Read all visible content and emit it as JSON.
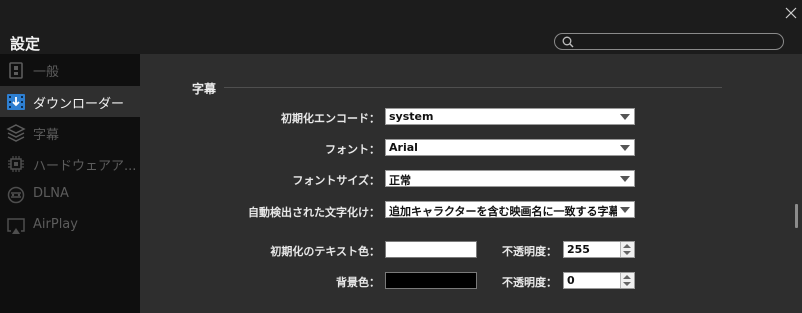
{
  "window": {
    "title": "設定"
  },
  "search": {
    "value": "",
    "placeholder": ""
  },
  "sidebar": {
    "items": [
      {
        "label": "一般",
        "icon": "general-icon",
        "active": false
      },
      {
        "label": "ダウンローダー",
        "icon": "download-icon",
        "active": true
      },
      {
        "label": "字幕",
        "icon": "subtitle-layers-icon",
        "active": false
      },
      {
        "label": "ハードウェアア...",
        "icon": "chip-icon",
        "active": false
      },
      {
        "label": "DLNA",
        "icon": "dlna-icon",
        "active": false
      },
      {
        "label": "AirPlay",
        "icon": "airplay-icon",
        "active": false
      }
    ]
  },
  "subtitle_section": {
    "title": "字幕",
    "initial_encoding": {
      "label": "初期化エンコード：",
      "value": "system"
    },
    "font": {
      "label": "フォント：",
      "value": "Arial"
    },
    "font_size": {
      "label": "フォントサイズ：",
      "value": "正常"
    },
    "auto_detected_charset": {
      "label": "自動検出された文字化け：",
      "value": "追加キャラクターを含む映画名に一致する字幕:"
    },
    "text_color": {
      "label": "初期化のテキスト色：",
      "color": "#ffffff"
    },
    "text_opacity": {
      "label": "不透明度：",
      "value": "255"
    },
    "background_color": {
      "label": "背景色：",
      "color": "#000000"
    },
    "background_opacity": {
      "label": "不透明度：",
      "value": "0"
    }
  },
  "colors": {
    "active_nav_bg": "#2f2f2f",
    "main_bg": "#2e2e2e",
    "sidebar_bg": "#0f0f0f",
    "download_icon_accent": "#2e7fd1"
  }
}
